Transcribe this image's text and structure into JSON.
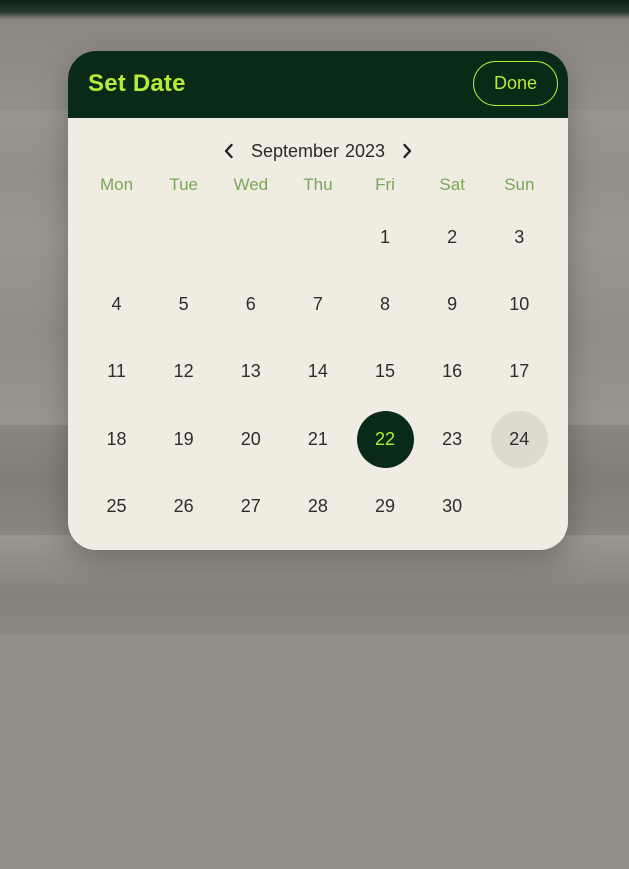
{
  "dialog": {
    "title": "Set Date",
    "done_label": "Done"
  },
  "calendar": {
    "month": "September",
    "year": "2023",
    "weekdays": [
      "Mon",
      "Tue",
      "Wed",
      "Thu",
      "Fri",
      "Sat",
      "Sun"
    ],
    "leading_blanks": 4,
    "days": [
      "1",
      "2",
      "3",
      "4",
      "5",
      "6",
      "7",
      "8",
      "9",
      "10",
      "11",
      "12",
      "13",
      "14",
      "15",
      "16",
      "17",
      "18",
      "19",
      "20",
      "21",
      "22",
      "23",
      "24",
      "25",
      "26",
      "27",
      "28",
      "29",
      "30"
    ],
    "selected_day": "22",
    "highlighted_day": "24"
  },
  "colors": {
    "header_bg": "#0a2a18",
    "accent": "#b5ec3a",
    "surface": "#f0ece1",
    "weekday_text": "#79a65a",
    "highlight_bg": "#dddad0"
  },
  "icons": {
    "prev": "chevron-left-icon",
    "next": "chevron-right-icon"
  }
}
